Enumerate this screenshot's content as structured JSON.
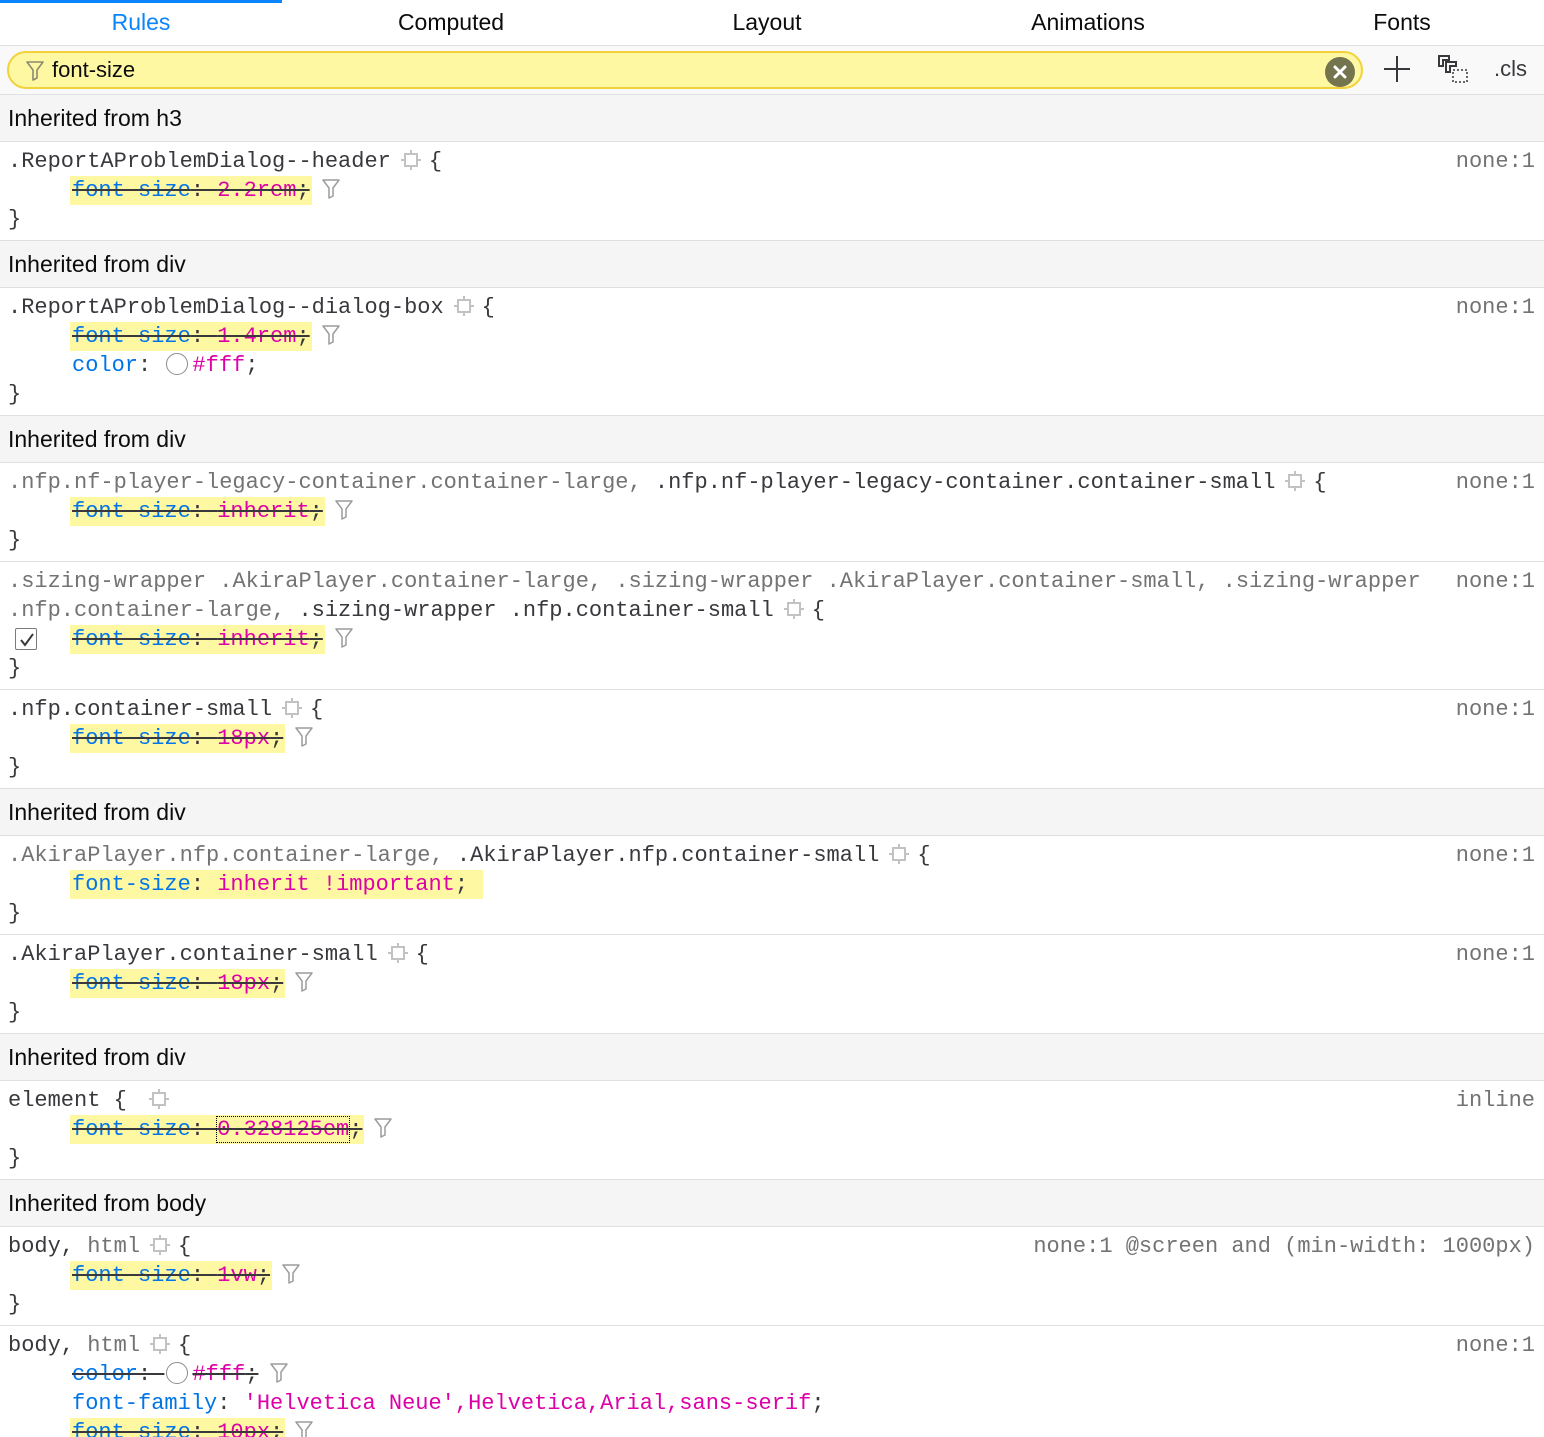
{
  "tabs": [
    "Rules",
    "Computed",
    "Layout",
    "Animations",
    "Fonts"
  ],
  "filter": {
    "value": "font-size"
  },
  "toolbar": {
    "add_label": "+",
    "cls_label": ".cls"
  },
  "headers": [
    "Inherited from h3",
    "Inherited from div",
    "Inherited from div",
    "Inherited from div",
    "Inherited from div",
    "Inherited from body"
  ],
  "rules": [
    {
      "sel1": ".ReportAProblemDialog--header",
      "src": "none:1",
      "d0n": "font-size",
      "d0v": "2.2rem"
    },
    {
      "sel1": ".ReportAProblemDialog--dialog-box",
      "src": "none:1",
      "d0n": "font-size",
      "d0v": "1.4rem",
      "d1n": "color",
      "d1v": "#fff"
    },
    {
      "sel1": ".nfp.nf-player-legacy-container.container-large,",
      "sel2": ".nfp.nf-player-legacy-container.container-small",
      "src": "none:1",
      "d0n": "font-size",
      "d0v": "inherit"
    },
    {
      "sel1": ".sizing-wrapper",
      "sel2": ".AkiraPlayer.container-large,",
      "sel3": ".sizing-wrapper",
      "sel4": ".AkiraPlayer.container-small,",
      "sel5": ".sizing-wrapper",
      "sel6": ".nfp.container-large,",
      "sel7": ".sizing-wrapper",
      "sel8": ".nfp.container-small",
      "src": "none:1",
      "d0n": "font-size",
      "d0v": "inherit"
    },
    {
      "sel1": ".nfp.container-small",
      "src": "none:1",
      "d0n": "font-size",
      "d0v": "18px"
    },
    {
      "sel1": ".AkiraPlayer.nfp.container-large,",
      "sel2": ".AkiraPlayer.nfp.container-small",
      "src": "none:1",
      "d0n": "font-size",
      "d0v": "inherit !important"
    },
    {
      "sel1": ".AkiraPlayer.container-small",
      "src": "none:1",
      "d0n": "font-size",
      "d0v": "18px"
    },
    {
      "sel1": "element",
      "src": "inline",
      "d0n": "font-size",
      "d0v": "0.328125em"
    },
    {
      "sel1": "body,",
      "sel2": "html",
      "src": "none:1 @screen and (min-width: 1000px)",
      "d0n": "font-size",
      "d0v": "1vw"
    },
    {
      "sel1": "body,",
      "sel2": "html",
      "src": "none:1",
      "d0n": "color",
      "d0v": "#fff",
      "d1n": "font-family",
      "d1v": "'Helvetica Neue',Helvetica,Arial,sans-serif",
      "d2n": "font-size",
      "d2v": "10px"
    }
  ],
  "icons": {
    "filter": "filter-funnel-icon",
    "clear": "clear-circle-icon",
    "add": "plus-icon",
    "print": "print-simulation-icon",
    "gear": "gear-icon"
  },
  "colors": {
    "accent": "#0a84ff",
    "highlight": "#fff8a3",
    "prop": "#0074e8",
    "value": "#dd00a9"
  }
}
